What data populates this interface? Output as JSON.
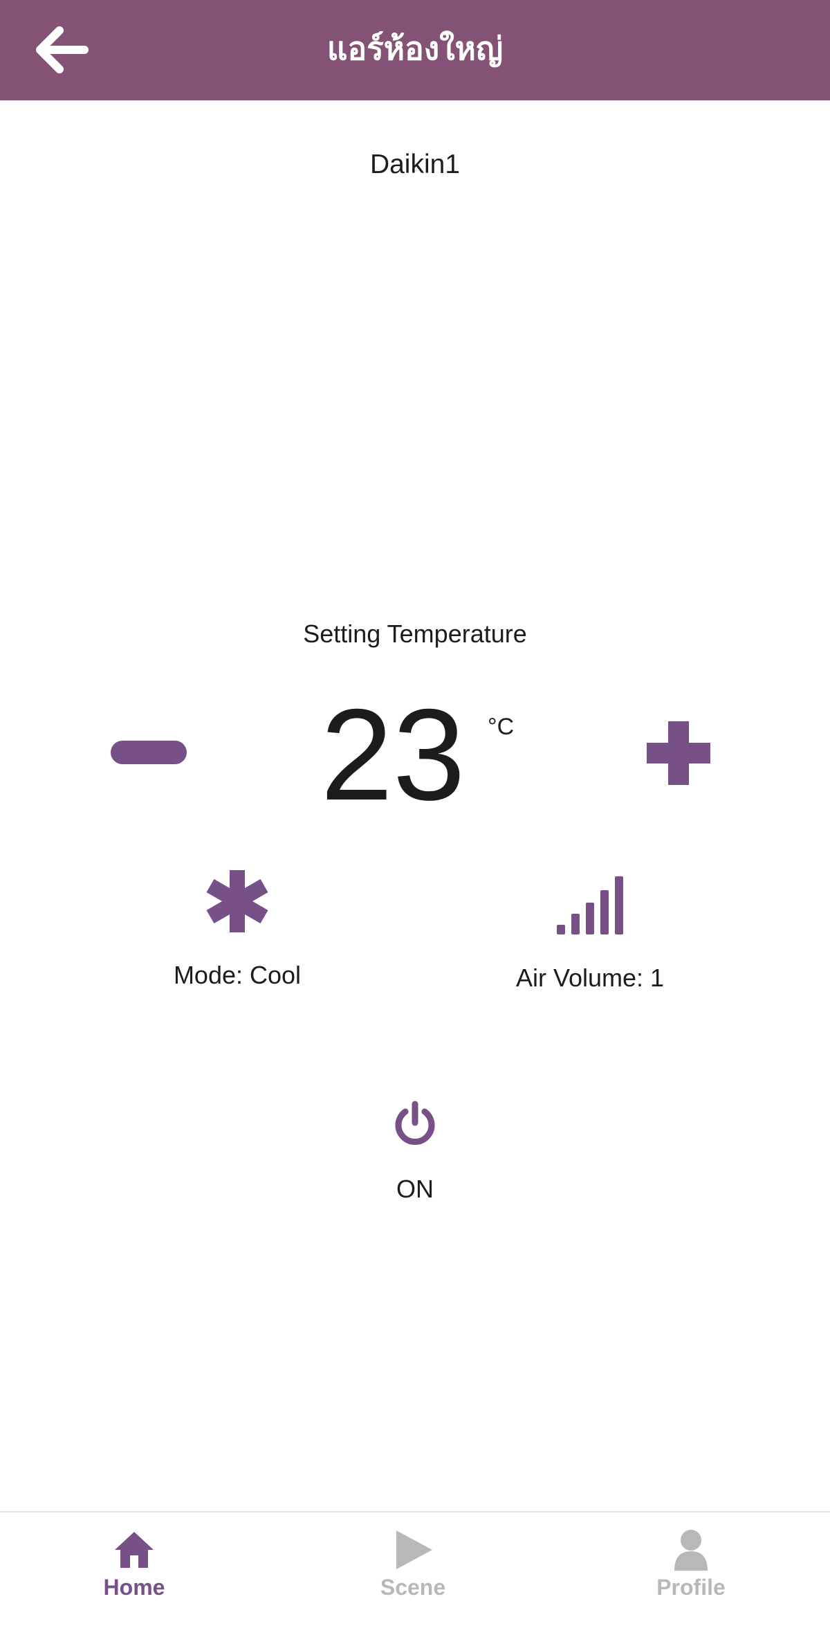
{
  "header": {
    "title": "แอร์ห้องใหญ่",
    "back_icon": "arrow-left-icon",
    "background_color": "#845275"
  },
  "device": {
    "name": "Daikin1"
  },
  "temperature": {
    "label": "Setting Temperature",
    "value": "23",
    "unit": "°C",
    "decrease_icon": "minus-icon",
    "increase_icon": "plus-icon"
  },
  "mode": {
    "icon": "snowflake-icon",
    "label": "Mode: Cool"
  },
  "air_volume": {
    "icon": "signal-bars-icon",
    "label": "Air Volume: 1"
  },
  "power": {
    "icon": "power-icon",
    "label": "ON"
  },
  "tabbar": {
    "tabs": [
      {
        "label": "Home",
        "icon": "home-icon",
        "active": true
      },
      {
        "label": "Scene",
        "icon": "play-icon",
        "active": false
      },
      {
        "label": "Profile",
        "icon": "user-icon",
        "active": false
      }
    ],
    "active_color": "#765086",
    "inactive_color": "#b8b8b8"
  },
  "accent_color": "#765086"
}
